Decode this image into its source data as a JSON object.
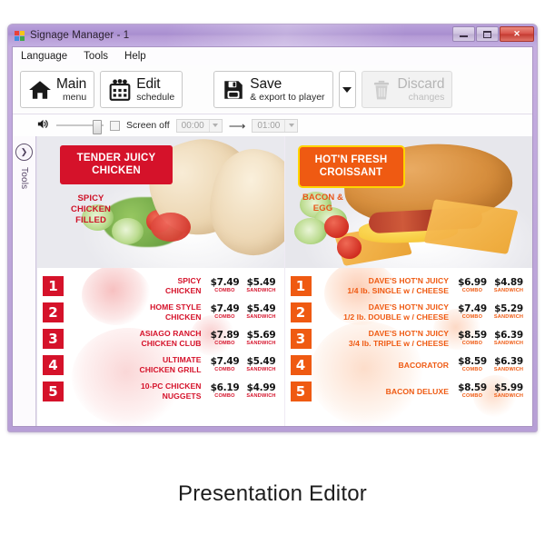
{
  "window": {
    "title": "Signage Manager - 1",
    "app_icon": "app-logo-icon",
    "buttons": {
      "minimize": "minimize-button",
      "maximize": "maximize-button",
      "close": "✕"
    }
  },
  "menubar": {
    "items": [
      {
        "label": "Language"
      },
      {
        "label": "Tools"
      },
      {
        "label": "Help"
      }
    ]
  },
  "toolbar": {
    "main_big": "Main",
    "main_small": "menu",
    "main_icon": "home-icon",
    "edit_big": "Edit",
    "edit_small": "schedule",
    "edit_icon": "calendar-icon",
    "save_big": "Save",
    "save_small": "& export to player",
    "save_icon": "floppy-disk-icon",
    "save_dropdown_icon": "chevron-down-icon",
    "discard_big": "Discard",
    "discard_small": "changes",
    "discard_icon": "trash-icon"
  },
  "options": {
    "volume_icon": "speaker-icon",
    "screen_off_label": "Screen off",
    "time_from": "00:00",
    "time_to": "01:00",
    "arrow_icon": "arrow-right-icon"
  },
  "tools_rail": {
    "toggle_icon": "chevron-right-circle-icon",
    "label": "Tools"
  },
  "boards": {
    "left": {
      "banner": "TENDER JUICY\nCHICKEN",
      "banner_line1": "TENDER JUICY",
      "banner_line2": "CHICKEN",
      "sublabel": "SPICY\nCHICKEN\nFILLED",
      "accent": "#d5122a",
      "combo_label": "COMBO",
      "sandwich_label": "SANDWICH",
      "items": [
        {
          "rank": "1",
          "name_line1": "SPICY",
          "name_line2": "CHICKEN",
          "combo": "$7.49",
          "sandwich": "$5.49"
        },
        {
          "rank": "2",
          "name_line1": "HOME STYLE",
          "name_line2": "CHICKEN",
          "combo": "$7.49",
          "sandwich": "$5.49"
        },
        {
          "rank": "3",
          "name_line1": "ASIAGO RANCH",
          "name_line2": "CHICKEN CLUB",
          "combo": "$7.89",
          "sandwich": "$5.69"
        },
        {
          "rank": "4",
          "name_line1": "ULTIMATE",
          "name_line2": "CHICKEN GRILL",
          "combo": "$7.49",
          "sandwich": "$5.49"
        },
        {
          "rank": "5",
          "name_line1": "10-PC CHICKEN",
          "name_line2": "NUGGETS",
          "combo": "$6.19",
          "sandwich": "$4.99"
        }
      ]
    },
    "right": {
      "banner_line1": "HOT'N FRESH",
      "banner_line2": "CROISSANT",
      "sublabel": "BACON &\nEGG",
      "accent": "#ef5a12",
      "combo_label": "COMBO",
      "sandwich_label": "SANDWICH",
      "items": [
        {
          "rank": "1",
          "name_line1": "DAVE'S HOT'N JUICY",
          "name_line2": "1/4 lb. SINGLE w / CHEESE",
          "combo": "$6.99",
          "sandwich": "$4.89"
        },
        {
          "rank": "2",
          "name_line1": "DAVE'S HOT'N JUICY",
          "name_line2": "1/2 lb. DOUBLE w / CHEESE",
          "combo": "$7.49",
          "sandwich": "$5.29"
        },
        {
          "rank": "3",
          "name_line1": "DAVE'S HOT'N JUICY",
          "name_line2": "3/4 lb. TRIPLE w / CHEESE",
          "combo": "$8.59",
          "sandwich": "$6.39"
        },
        {
          "rank": "4",
          "name_line1": "",
          "name_line2": "BACORATOR",
          "combo": "$8.59",
          "sandwich": "$6.39"
        },
        {
          "rank": "5",
          "name_line1": "",
          "name_line2": "BACON DELUXE",
          "combo": "$8.59",
          "sandwich": "$5.99"
        }
      ]
    }
  },
  "caption": "Presentation Editor"
}
